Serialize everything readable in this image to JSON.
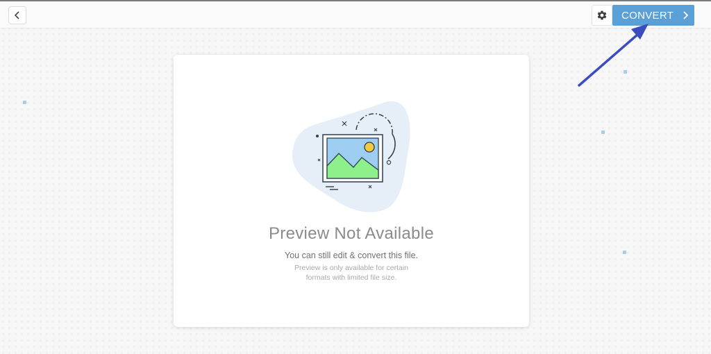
{
  "toolbar": {
    "back_icon": "chevron-left-icon",
    "settings_icon": "gear-icon",
    "convert_label": "CONVERT",
    "convert_icon": "chevron-right-icon",
    "accent_color": "#5a9fd6"
  },
  "preview": {
    "illustration_icon": "image-placeholder-icon",
    "title": "Preview Not Available",
    "subtitle": "You can still edit & convert this file.",
    "note_lines": [
      "Preview is only available for certain",
      "formats with limited file size."
    ]
  },
  "annotation": {
    "arrow_icon": "pointer-arrow-icon",
    "arrow_color": "#3b4cc0"
  }
}
